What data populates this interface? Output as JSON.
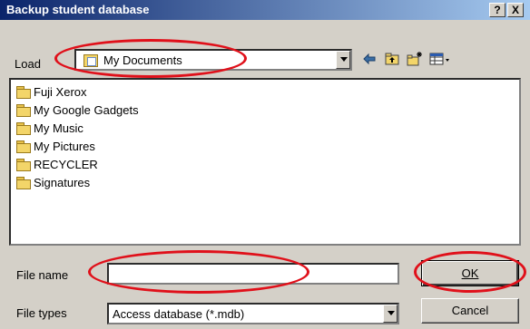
{
  "window": {
    "title": "Backup student database",
    "help_label": "?",
    "close_label": "X"
  },
  "load": {
    "label": "Load",
    "value": "My Documents"
  },
  "toolbar": {
    "icons": [
      "back-arrow-icon",
      "up-folder-icon",
      "new-folder-icon",
      "view-menu-icon"
    ]
  },
  "folders": [
    "Fuji Xerox",
    "My Google Gadgets",
    "My Music",
    "My Pictures",
    "RECYCLER",
    "Signatures"
  ],
  "file_name": {
    "label": "File name",
    "value": ""
  },
  "file_types": {
    "label": "File types",
    "value": "Access database (*.mdb)"
  },
  "buttons": {
    "ok": "OK",
    "cancel": "Cancel"
  },
  "annotation_color": "#e0101a"
}
